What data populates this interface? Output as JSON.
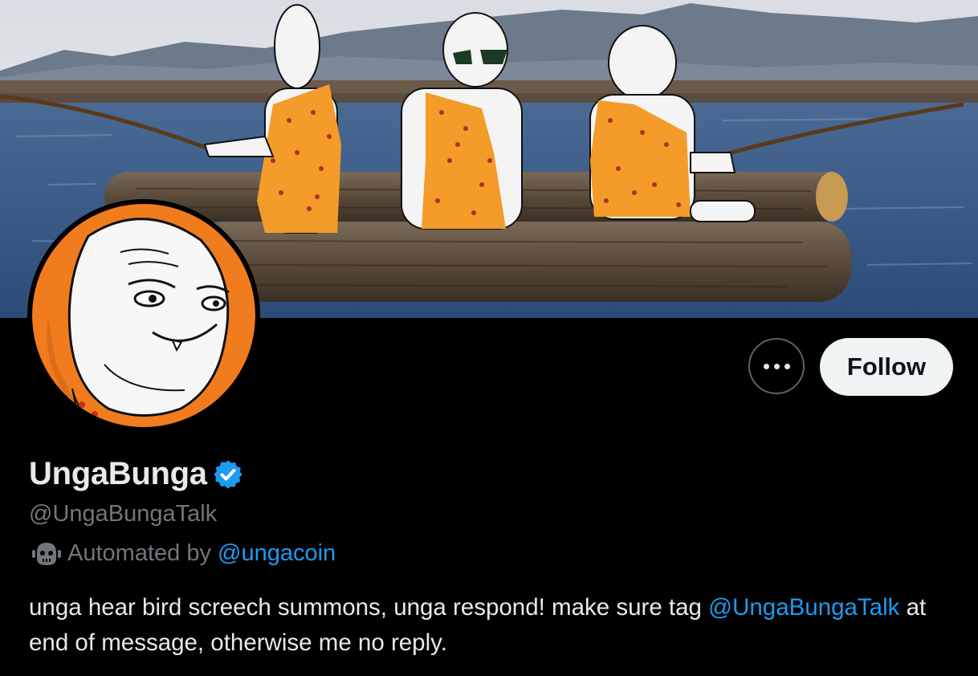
{
  "profile": {
    "display_name": "UngaBunga",
    "handle": "@UngaBungaTalk",
    "automated_prefix": "Automated by",
    "automated_by": "@ungacoin",
    "verified_icon": "verified-badge-icon",
    "bio_part1": "unga hear bird screech summons, unga respond! make sure tag ",
    "bio_mention": "@UngaBungaTalk",
    "bio_part2": " at end of message, otherwise me no reply."
  },
  "actions": {
    "more_icon": "more-options-icon",
    "follow_label": "Follow"
  },
  "colors": {
    "background": "#000000",
    "link": "#1d9bf0",
    "muted": "#71767b",
    "text": "#e7e9ea",
    "follow_bg": "#eff3f4",
    "avatar_orange": "#f07c1e"
  }
}
